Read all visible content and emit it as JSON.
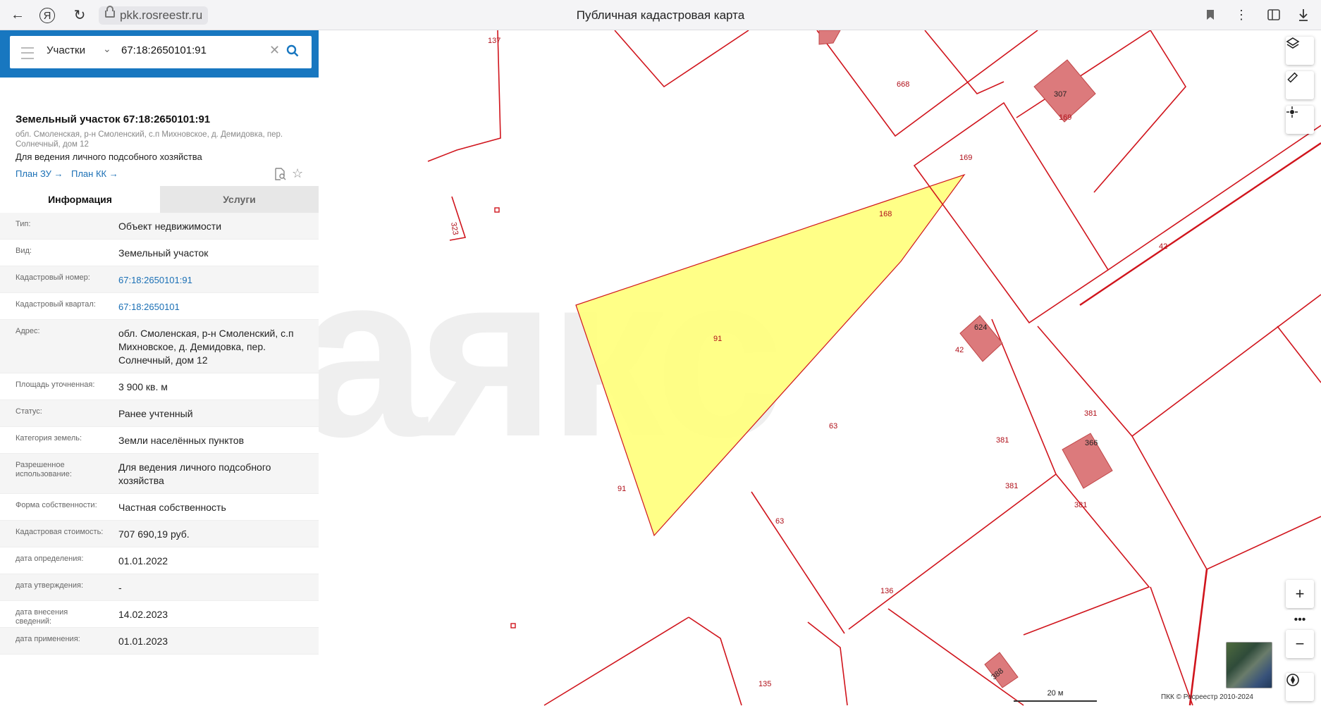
{
  "browser": {
    "url": "pkk.rosreestr.ru",
    "tab_title": "Публичная кадастровая карта",
    "back_icon": "←",
    "yandex_icon": "Я",
    "reload_icon": "↻"
  },
  "search": {
    "type": "Участки",
    "query": "67:18:2650101:91"
  },
  "parcel": {
    "title": "Земельный участок 67:18:2650101:91",
    "address": "обл. Смоленская, р-н Смоленский, с.п Михновское, д. Демидовка, пер. Солнечный, дом 12",
    "purpose": "Для ведения личного подсобного хозяйства",
    "plan_zu": "План ЗУ →",
    "plan_kk": "План КК →"
  },
  "tabs": [
    "Информация",
    "Услуги"
  ],
  "properties": [
    {
      "label": "Тип:",
      "value": "Объект недвижимости"
    },
    {
      "label": "Вид:",
      "value": "Земельный участок"
    },
    {
      "label": "Кадастровый номер:",
      "value": "67:18:2650101:91",
      "link": true
    },
    {
      "label": "Кадастровый квартал:",
      "value": "67:18:2650101",
      "link": true
    },
    {
      "label": "Адрес:",
      "value": "обл. Смоленская, р-н Смоленский, с.п Михновское, д. Демидовка, пер. Солнечный, дом 12"
    },
    {
      "label": "Площадь уточненная:",
      "value": "3 900 кв. м"
    },
    {
      "label": "Статус:",
      "value": "Ранее учтенный"
    },
    {
      "label": "Категория земель:",
      "value": "Земли населённых пунктов"
    },
    {
      "label": "Разрешенное использование:",
      "value": "Для ведения личного подсобного хозяйства"
    },
    {
      "label": "Форма собственности:",
      "value": "Частная собственность"
    },
    {
      "label": "Кадастровая стоимость:",
      "value": "707 690,19 руб."
    },
    {
      "label": "дата определения:",
      "value": "01.01.2022"
    },
    {
      "label": "дата утверждения:",
      "value": "-"
    },
    {
      "label": "дата внесения сведений:",
      "value": "14.02.2023"
    },
    {
      "label": "дата применения:",
      "value": "01.01.2023"
    }
  ],
  "map": {
    "parcel_labels": [
      "137",
      "323",
      "668",
      "307",
      "169",
      "169",
      "168",
      "42",
      "624",
      "42",
      "91",
      "91",
      "63",
      "63",
      "381",
      "366",
      "381",
      "381",
      "381",
      "136",
      "135",
      "388"
    ],
    "watermark": "аякс",
    "scale": "20 м",
    "copyright": "ПКК © Росреестр 2010-2024",
    "colors": {
      "parcel_line": "#d0141c",
      "selected_fill": "#ffff80",
      "building_fill": "#dc7a7c",
      "header": "#1877c0"
    }
  }
}
